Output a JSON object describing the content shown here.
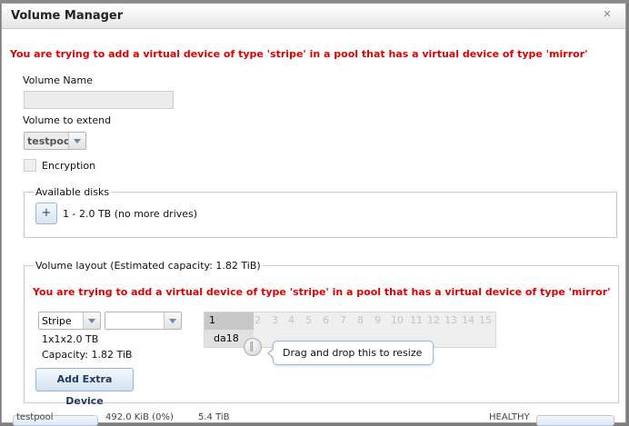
{
  "dialog": {
    "title": "Volume Manager",
    "close_icon": "close-icon"
  },
  "warning_top": "You are trying to add a virtual device of type 'stripe' in a pool that has a virtual device of type 'mirror'",
  "volume_name": {
    "label": "Volume Name",
    "value": ""
  },
  "volume_extend": {
    "label": "Volume to extend",
    "selected": "testpool"
  },
  "encryption": {
    "label": "Encryption",
    "checked": false
  },
  "available_disks": {
    "legend": "Available disks",
    "add_button": "+",
    "item": "1 - 2.0 TB (no more drives)"
  },
  "volume_layout": {
    "legend": "Volume layout (Estimated capacity: 1.82 TiB)",
    "warning": "You are trying to add a virtual device of type 'stripe' in a pool that has a virtual device of type 'mirror'",
    "layout_type": "Stripe",
    "second_select": "",
    "summary": "1x1x2.0 TB",
    "capacity": "Capacity: 1.82 TiB",
    "add_extra_device": "Add Extra Device",
    "grid_columns": [
      "1",
      "2",
      "3",
      "4",
      "5",
      "6",
      "7",
      "8",
      "9",
      "10",
      "11",
      "12",
      "13",
      "14",
      "15"
    ],
    "disk": "da18",
    "tooltip": "Drag and drop this to resize"
  },
  "background": {
    "fragments": [
      "testpool",
      "492.0 KiB (0%)",
      "5.4 TiB",
      "HEALTHY"
    ]
  },
  "colors": {
    "warning": "#e00000",
    "accent_border": "#98b6d6"
  }
}
